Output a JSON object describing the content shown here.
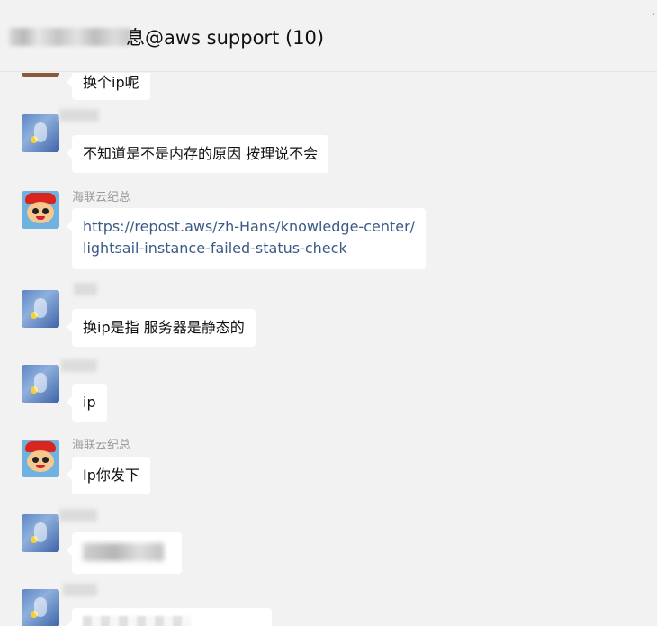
{
  "header": {
    "title": "息@aws support (10)",
    "corner_mark": "‘"
  },
  "messages": [
    {
      "id": "m1",
      "sender": "",
      "text": "换个ip呢"
    },
    {
      "id": "m2",
      "sender": "",
      "text": "不知道是不是内存的原因 按理说不会"
    },
    {
      "id": "m3",
      "sender": "海联云纪总",
      "link_line1": "https://repost.aws/zh-Hans/knowledge-center/",
      "link_line2": "lightsail-instance-failed-status-check"
    },
    {
      "id": "m4",
      "sender": "",
      "text": "换ip是指 服务器是静态的"
    },
    {
      "id": "m5",
      "sender": "",
      "text": "ip"
    },
    {
      "id": "m6",
      "sender": "海联云纪总",
      "text": "Ip你发下"
    },
    {
      "id": "m7",
      "sender": "",
      "text": ""
    },
    {
      "id": "m8",
      "sender": "",
      "text": ""
    }
  ]
}
